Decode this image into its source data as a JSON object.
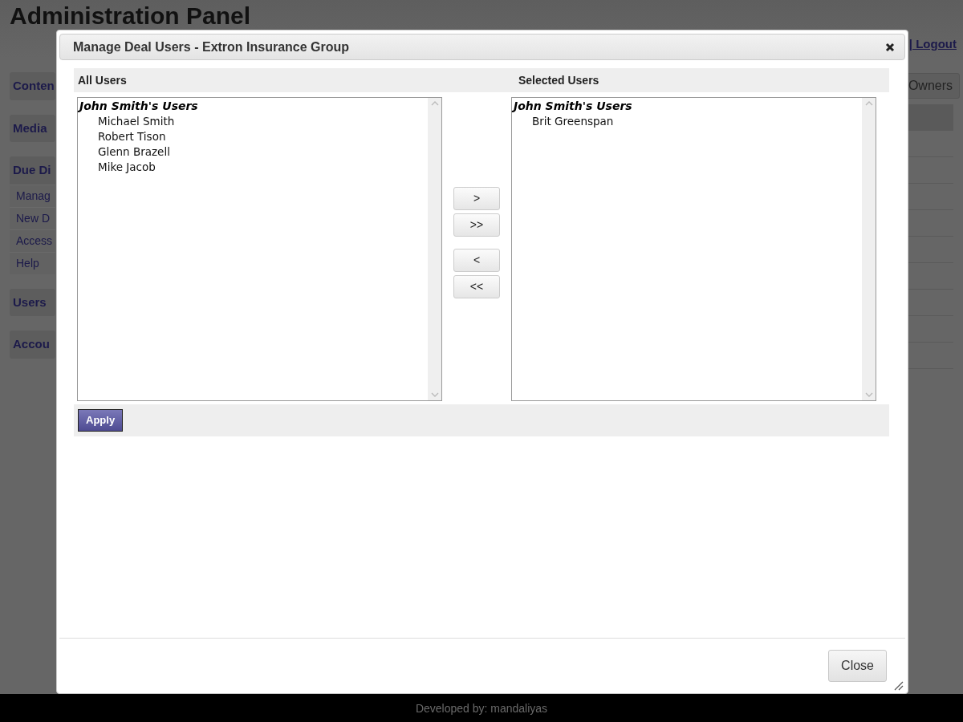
{
  "page": {
    "title": "Administration Panel",
    "header_link": "| Logout",
    "owners_button": "Owners",
    "sidebar": [
      {
        "label": "Conten"
      },
      {
        "label": "Media"
      },
      {
        "label": "Due Di",
        "children": [
          {
            "label": "Manag"
          },
          {
            "label": "New D"
          },
          {
            "label": "Access"
          },
          {
            "label": "Help"
          }
        ]
      },
      {
        "label": "Users"
      },
      {
        "label": "Accou"
      }
    ],
    "footer": "Developed by: mandaliyas"
  },
  "dialog": {
    "title": "Manage Deal Users - Extron Insurance Group",
    "all_users": {
      "heading": "All Users",
      "groups": [
        {
          "label": "John Smith's Users",
          "children": [
            {
              "label": "Michael Smith"
            },
            {
              "label": "Robert Tison"
            },
            {
              "label": "Glenn Brazell"
            },
            {
              "label": "Mike Jacob"
            }
          ]
        }
      ]
    },
    "transfer_buttons": [
      ">",
      ">>",
      "<",
      "<<"
    ],
    "selected_users": {
      "heading": "Selected Users",
      "groups": [
        {
          "label": "John Smith's Users",
          "children": [
            {
              "label": "Brit Greenspan"
            }
          ]
        }
      ]
    },
    "apply_button": "Apply",
    "close_button": "Close"
  }
}
